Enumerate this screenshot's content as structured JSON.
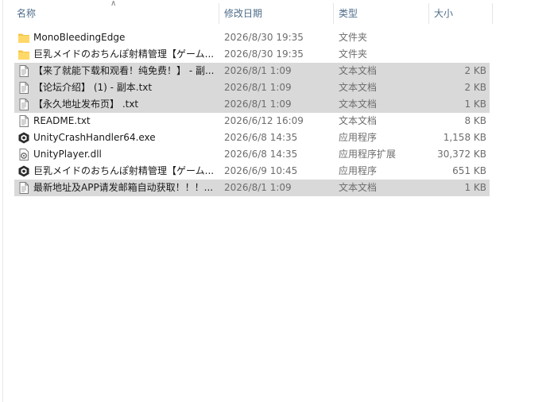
{
  "columns": {
    "name": "名称",
    "date": "修改日期",
    "type": "类型",
    "size": "大小"
  },
  "files": [
    {
      "name": "MonoBleedingEdge",
      "date": "2026/8/30 19:35",
      "type": "文件夹",
      "size": "",
      "icon": "folder-icon",
      "selected": false
    },
    {
      "name": "巨乳メイドのおちんぽ射精管理【ゲーム...",
      "date": "2026/8/30 19:35",
      "type": "文件夹",
      "size": "",
      "icon": "folder-icon",
      "selected": false
    },
    {
      "name": "【来了就能下载和观看！纯免费！】 - 副...",
      "date": "2026/8/1 1:09",
      "type": "文本文档",
      "size": "2 KB",
      "icon": "text-file-icon",
      "selected": true
    },
    {
      "name": "【论坛介绍】 (1) - 副本.txt",
      "date": "2026/8/1 1:09",
      "type": "文本文档",
      "size": "2 KB",
      "icon": "text-file-icon",
      "selected": true
    },
    {
      "name": "【永久地址发布页】 .txt",
      "date": "2026/8/1 1:09",
      "type": "文本文档",
      "size": "1 KB",
      "icon": "text-file-icon",
      "selected": true
    },
    {
      "name": "README.txt",
      "date": "2026/6/12 16:09",
      "type": "文本文档",
      "size": "8 KB",
      "icon": "text-file-icon",
      "selected": false
    },
    {
      "name": "UnityCrashHandler64.exe",
      "date": "2026/6/8 14:35",
      "type": "应用程序",
      "size": "1,158 KB",
      "icon": "unity-exe-icon",
      "selected": false
    },
    {
      "name": "UnityPlayer.dll",
      "date": "2026/6/8 14:35",
      "type": "应用程序扩展",
      "size": "30,372 KB",
      "icon": "dll-file-icon",
      "selected": false
    },
    {
      "name": "巨乳メイドのおちんぽ射精管理【ゲーム...",
      "date": "2026/6/9 10:45",
      "type": "应用程序",
      "size": "651 KB",
      "icon": "unity-exe-icon",
      "selected": false
    },
    {
      "name": "最新地址及APP请发邮箱自动获取！！！...",
      "date": "2026/8/1 1:09",
      "type": "文本文档",
      "size": "1 KB",
      "icon": "text-file-icon",
      "selected": true
    }
  ]
}
